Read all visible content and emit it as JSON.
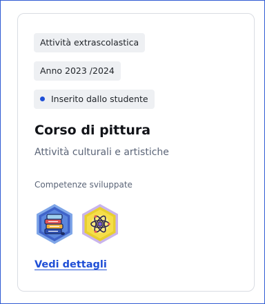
{
  "card": {
    "tags": {
      "type": "Attività extrascolastica",
      "year": "Anno 2023 /2024",
      "source": "Inserito dallo studente"
    },
    "title": "Corso di pittura",
    "subtitle": "Attività culturali e artistiche",
    "skills_label": "Competenze sviluppate",
    "badges": [
      {
        "icon": "books-icon",
        "color": "#3f63c9"
      },
      {
        "icon": "atom-icon",
        "color": "#e8cf2f"
      }
    ],
    "details_link": "Vedi dettagli"
  },
  "colors": {
    "accent": "#1f4fd6",
    "tag_background": "#eef0f3",
    "border": "#d9dce2"
  }
}
